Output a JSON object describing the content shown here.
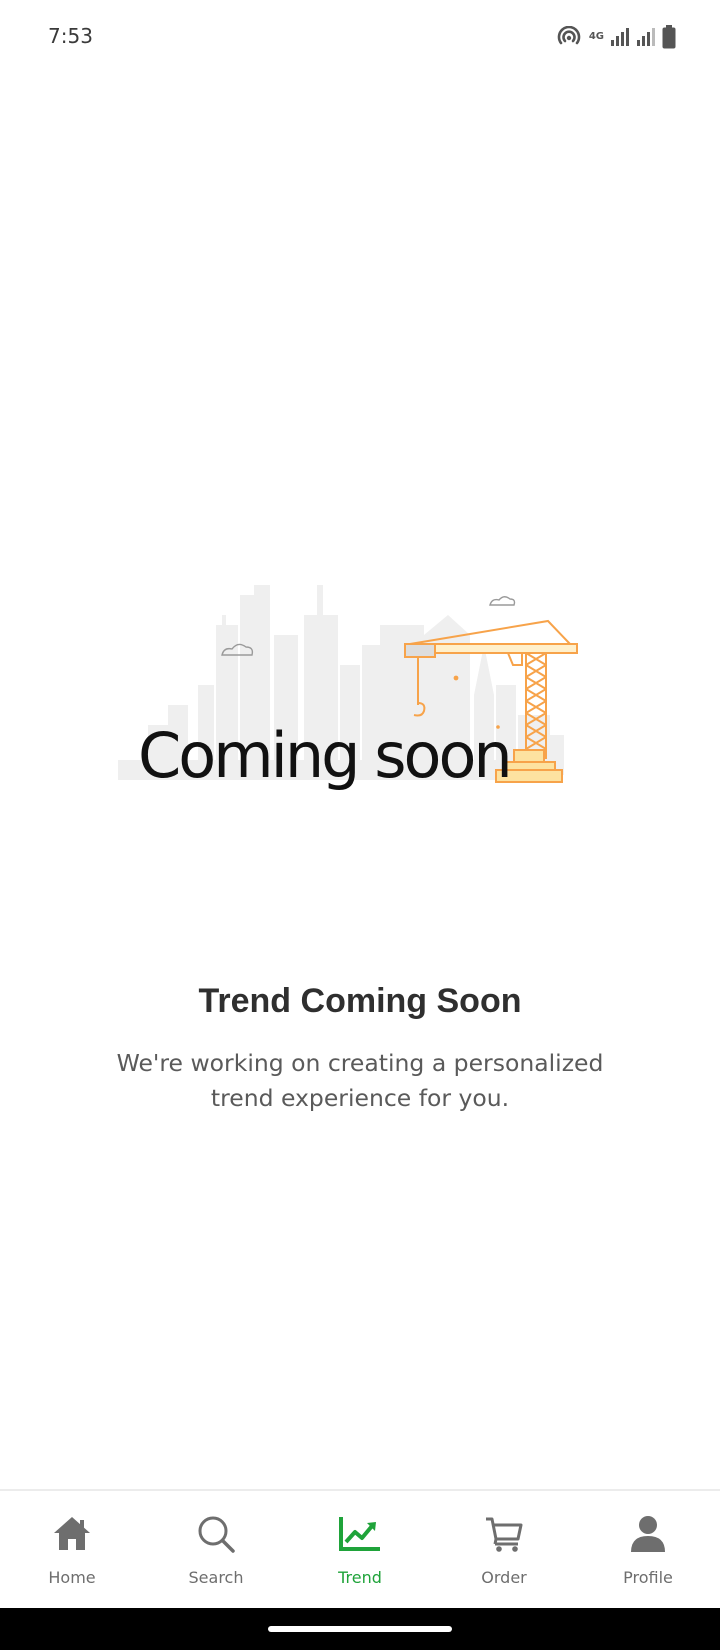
{
  "status_bar": {
    "time": "7:53",
    "network_label": "4G"
  },
  "illustration": {
    "text": "Coming soon"
  },
  "main": {
    "title": "Trend Coming Soon",
    "subtitle": "We're working on creating a personalized trend experience for you."
  },
  "nav": {
    "items": [
      {
        "label": "Home",
        "icon": "home-icon"
      },
      {
        "label": "Search",
        "icon": "search-icon"
      },
      {
        "label": "Trend",
        "icon": "trend-chart-icon"
      },
      {
        "label": "Order",
        "icon": "cart-icon"
      },
      {
        "label": "Profile",
        "icon": "person-icon"
      }
    ],
    "active_index": 2
  },
  "colors": {
    "accent": "#1fa33a",
    "inactive": "#6e6e6e",
    "crane": "#f7a34a",
    "crane_fill": "#fde2a0"
  }
}
